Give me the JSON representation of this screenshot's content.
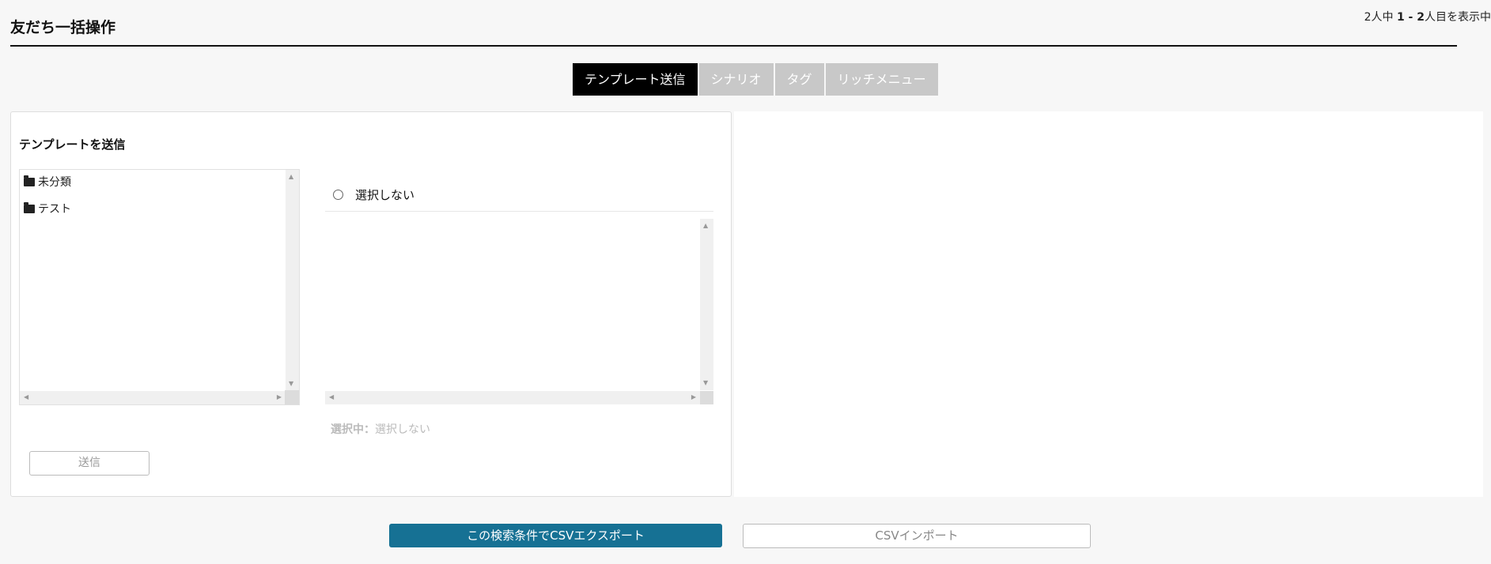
{
  "page": {
    "title": "友だち一括操作",
    "count": {
      "total": "2人中",
      "range_start": "1",
      "separator": " - ",
      "range_end": "2",
      "suffix": "人目を表示中"
    }
  },
  "tabs": [
    {
      "label": "テンプレート送信",
      "active": true
    },
    {
      "label": "シナリオ",
      "active": false
    },
    {
      "label": "タグ",
      "active": false
    },
    {
      "label": "リッチメニュー",
      "active": false
    }
  ],
  "template_panel": {
    "title": "テンプレートを送信",
    "folders": [
      {
        "label": "未分類",
        "icon": "folder-icon"
      },
      {
        "label": "テスト",
        "icon": "folder-icon"
      }
    ],
    "none_option": {
      "label": "選択しない",
      "checked": false
    },
    "selected_status": {
      "prefix": "選択中：",
      "value": "選択しない"
    },
    "send_label": "送信"
  },
  "actions": {
    "export_label": "この検索条件でCSVエクスポート",
    "import_label": "CSVインポート"
  },
  "colors": {
    "accent": "#167194",
    "active_tab": "#000000",
    "inactive_tab": "#c8c8c8"
  }
}
